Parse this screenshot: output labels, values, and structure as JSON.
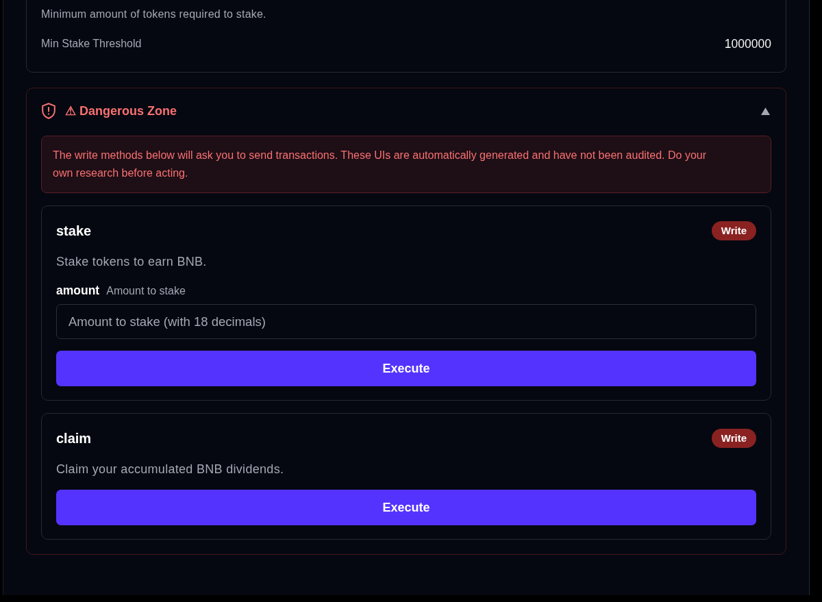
{
  "top_card": {
    "description": "Minimum amount of tokens required to stake.",
    "field": {
      "label": "Min Stake Threshold",
      "value": "1000000"
    }
  },
  "danger_zone": {
    "title": "⚠ Dangerous Zone",
    "expanded": true,
    "warning": "The write methods below will ask you to send transactions. These UIs are automatically generated and have not been audited. Do your own research before acting.",
    "methods": [
      {
        "name": "stake",
        "badge": "Write",
        "description": "Stake tokens to earn BNB.",
        "params": [
          {
            "name": "amount",
            "hint": "Amount to stake",
            "placeholder": "Amount to stake (with 18 decimals)"
          }
        ],
        "button": "Execute"
      },
      {
        "name": "claim",
        "badge": "Write",
        "description": "Claim your accumulated BNB dividends.",
        "button": "Execute"
      }
    ]
  }
}
